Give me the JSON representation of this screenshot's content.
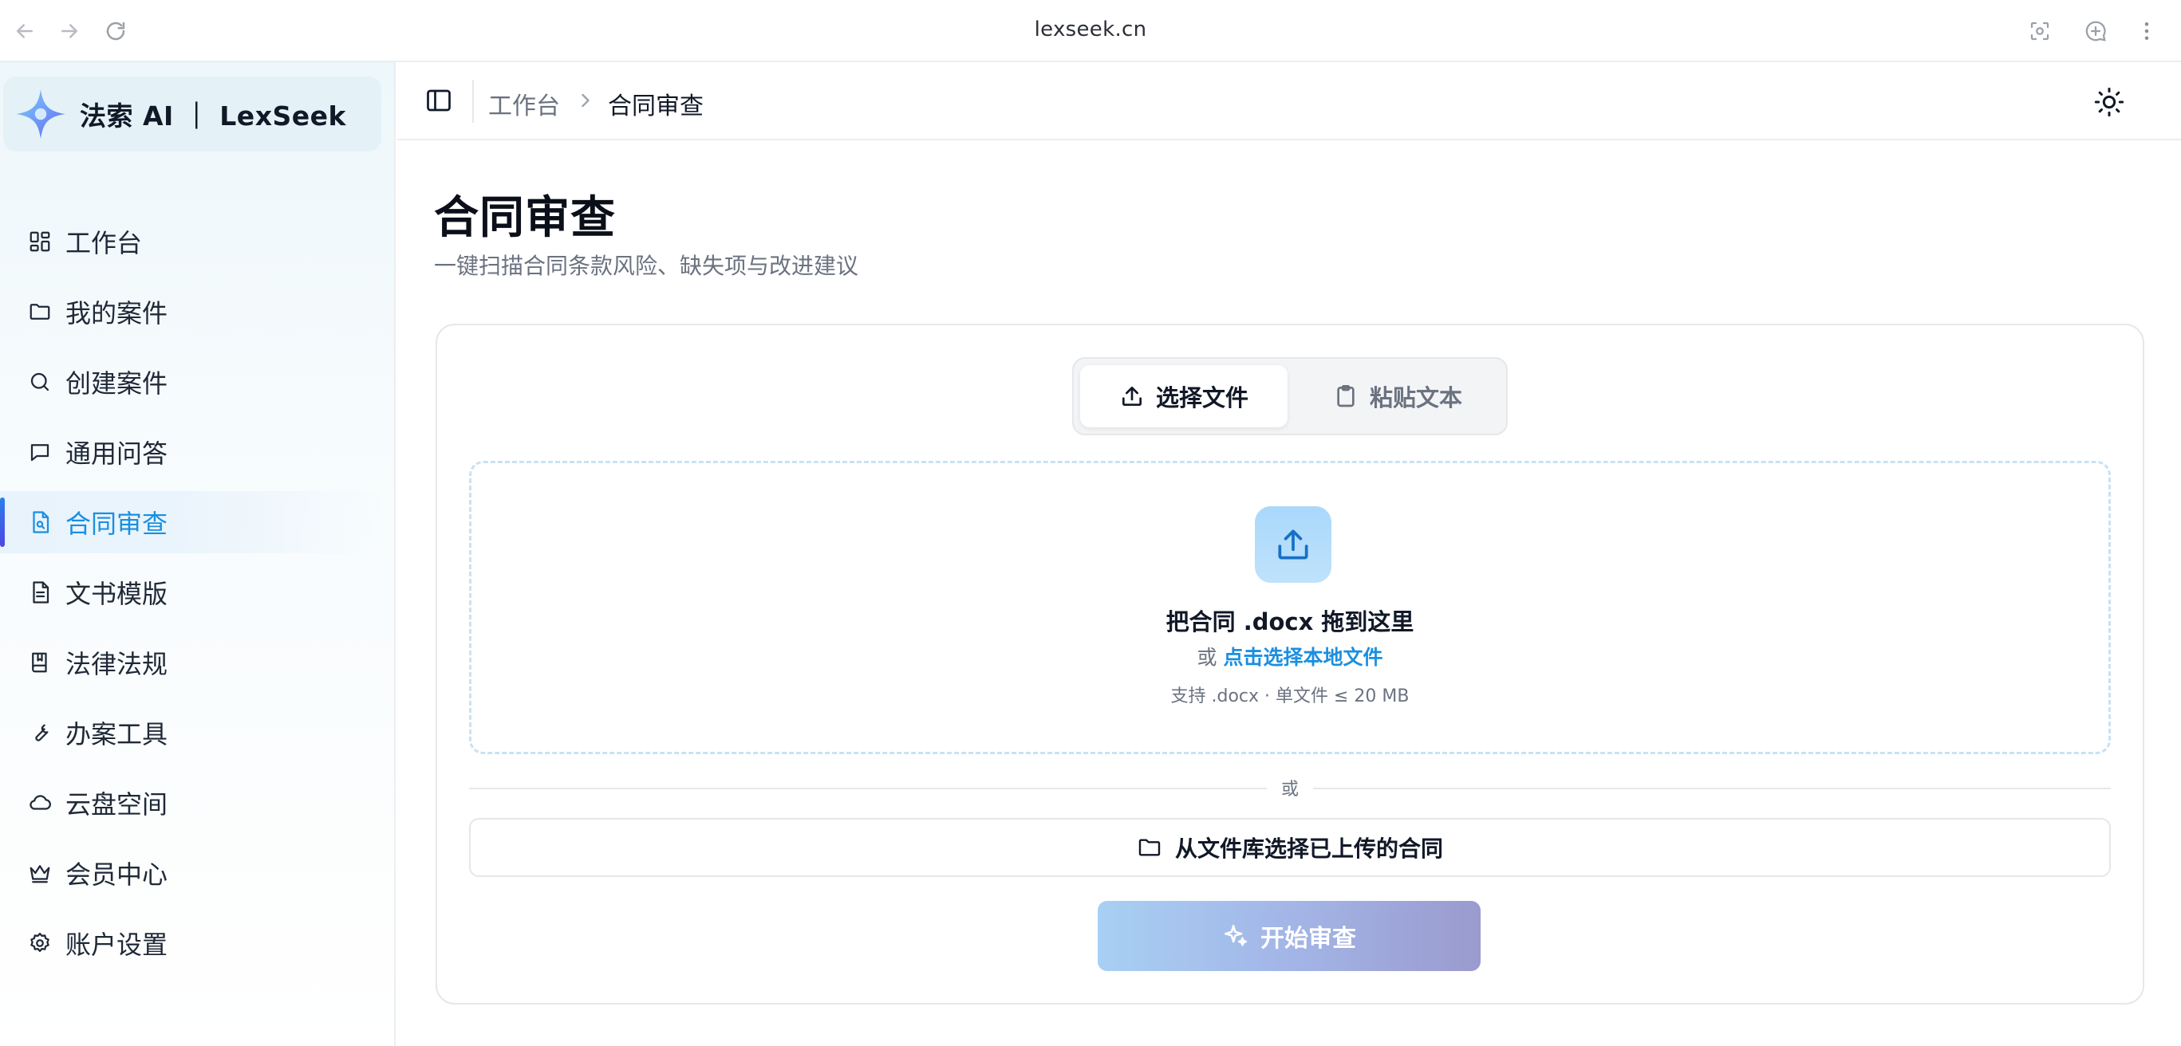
{
  "browser": {
    "url": "lexseek.cn",
    "icons": [
      "back-arrow-icon",
      "forward-arrow-icon",
      "reload-icon",
      "screenshot-icon",
      "new-chat-icon",
      "more-vertical-icon"
    ]
  },
  "brand": {
    "name": "法索 AI ｜ LexSeek",
    "logo_color_start": "#7dd3fc",
    "logo_color_end": "#6366f1"
  },
  "sidebar": {
    "items": [
      {
        "label": "工作台",
        "icon": "dashboard-grid-icon"
      },
      {
        "label": "我的案件",
        "icon": "folder-icon"
      },
      {
        "label": "创建案件",
        "icon": "search-icon"
      },
      {
        "label": "通用问答",
        "icon": "chat-bubble-icon"
      },
      {
        "label": "合同审查",
        "icon": "file-search-icon",
        "active": true
      },
      {
        "label": "文书模版",
        "icon": "document-icon"
      },
      {
        "label": "法律法规",
        "icon": "law-book-icon"
      },
      {
        "label": "办案工具",
        "icon": "wrench-icon"
      },
      {
        "label": "云盘空间",
        "icon": "cloud-icon"
      },
      {
        "label": "会员中心",
        "icon": "crown-icon"
      },
      {
        "label": "账户设置",
        "icon": "settings-gear-icon"
      }
    ],
    "accent_color": "#1a8fe0"
  },
  "topbar": {
    "breadcrumb": [
      "工作台",
      "合同审查"
    ]
  },
  "page": {
    "title": "合同审查",
    "subtitle": "一键扫描合同条款风险、缺失项与改进建议"
  },
  "input_mode": {
    "tabs": [
      "选择文件",
      "粘贴文本"
    ],
    "selected": "选择文件"
  },
  "dropzone": {
    "title": "把合同 .docx 拖到这里",
    "or_prefix": "或",
    "link_text": "点击选择本地文件",
    "hint": "支持 .docx · 单文件 ≤ 20 MB"
  },
  "divider_text": "或",
  "library_button": "从文件库选择已上传的合同",
  "start_button": "开始审查"
}
